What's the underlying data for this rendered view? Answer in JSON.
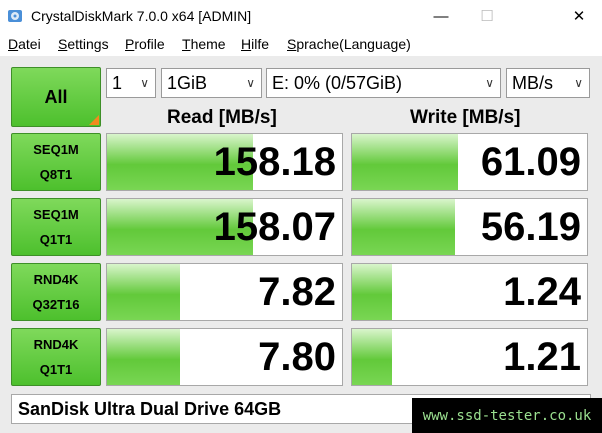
{
  "window": {
    "title": "CrystalDiskMark 7.0.0 x64 [ADMIN]",
    "icon": "disk-app-icon",
    "minimize_glyph": "—",
    "maximize_glyph": "☐",
    "close_glyph": "✕"
  },
  "menu": {
    "datei": {
      "u": "D",
      "rest": "atei"
    },
    "settings": {
      "u": "S",
      "rest": "ettings"
    },
    "profile": {
      "u": "P",
      "rest": "rofile"
    },
    "theme": {
      "u": "T",
      "rest": "heme"
    },
    "hilfe": {
      "u": "H",
      "rest": "ilfe"
    },
    "sprache": {
      "u": "S",
      "rest": "prache(Language)"
    }
  },
  "controls": {
    "all_label": "All",
    "count": "1",
    "size": "1GiB",
    "drive": "E: 0% (0/57GiB)",
    "unit": "MB/s",
    "chevron": "∨"
  },
  "headers": {
    "read": "Read [MB/s]",
    "write": "Write [MB/s]"
  },
  "tests": [
    {
      "line1": "SEQ1M",
      "line2": "Q8T1",
      "read": "158.18",
      "write": "61.09",
      "read_level": 0.62,
      "write_level": 0.45
    },
    {
      "line1": "SEQ1M",
      "line2": "Q1T1",
      "read": "158.07",
      "write": "56.19",
      "read_level": 0.62,
      "write_level": 0.44
    },
    {
      "line1": "RND4K",
      "line2": "Q32T16",
      "read": "7.82",
      "write": "1.24",
      "read_level": 0.31,
      "write_level": 0.17
    },
    {
      "line1": "RND4K",
      "line2": "Q1T1",
      "read": "7.80",
      "write": "1.21",
      "read_level": 0.31,
      "write_level": 0.17
    }
  ],
  "status_text": "SanDisk Ultra Dual Drive 64GB",
  "watermark": "www.ssd-tester.co.uk",
  "colors": {
    "accent_green": "#4dc02d",
    "corner_orange": "#f28a1e"
  }
}
